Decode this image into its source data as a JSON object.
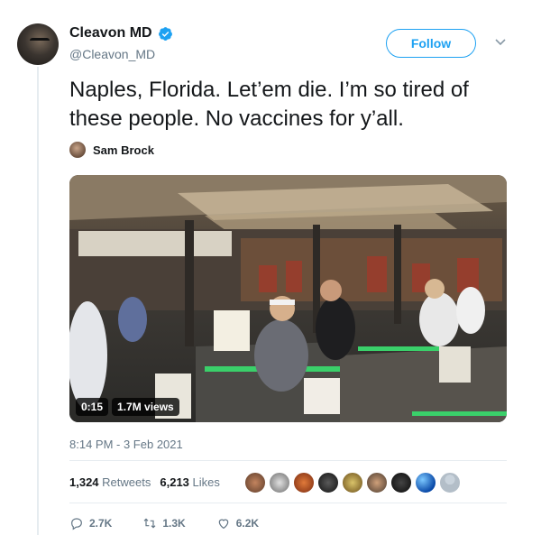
{
  "tweet": {
    "author": {
      "display_name": "Cleavon MD",
      "handle": "@Cleavon_MD",
      "verified": true
    },
    "follow_label": "Follow",
    "text": "Naples, Florida. Let’em die. I’m so tired of these people. No vaccines for y’all.",
    "attribution": {
      "name": "Sam Brock"
    },
    "video": {
      "duration": "0:15",
      "views": "1.7M views"
    },
    "timestamp": "8:14 PM - 3 Feb 2021",
    "stats": {
      "retweets_count": "1,324",
      "retweets_label": "Retweets",
      "likes_count": "6,213",
      "likes_label": "Likes"
    },
    "actions": {
      "replies": "2.7K",
      "retweets": "1.3K",
      "likes": "6.2K"
    }
  },
  "colors": {
    "accent": "#1da1f2",
    "muted": "#657786",
    "text": "#14171a",
    "divider": "#e6ecf0"
  },
  "icons": [
    "verified-badge-icon",
    "chevron-down-icon",
    "reply-icon",
    "retweet-icon",
    "like-icon"
  ]
}
